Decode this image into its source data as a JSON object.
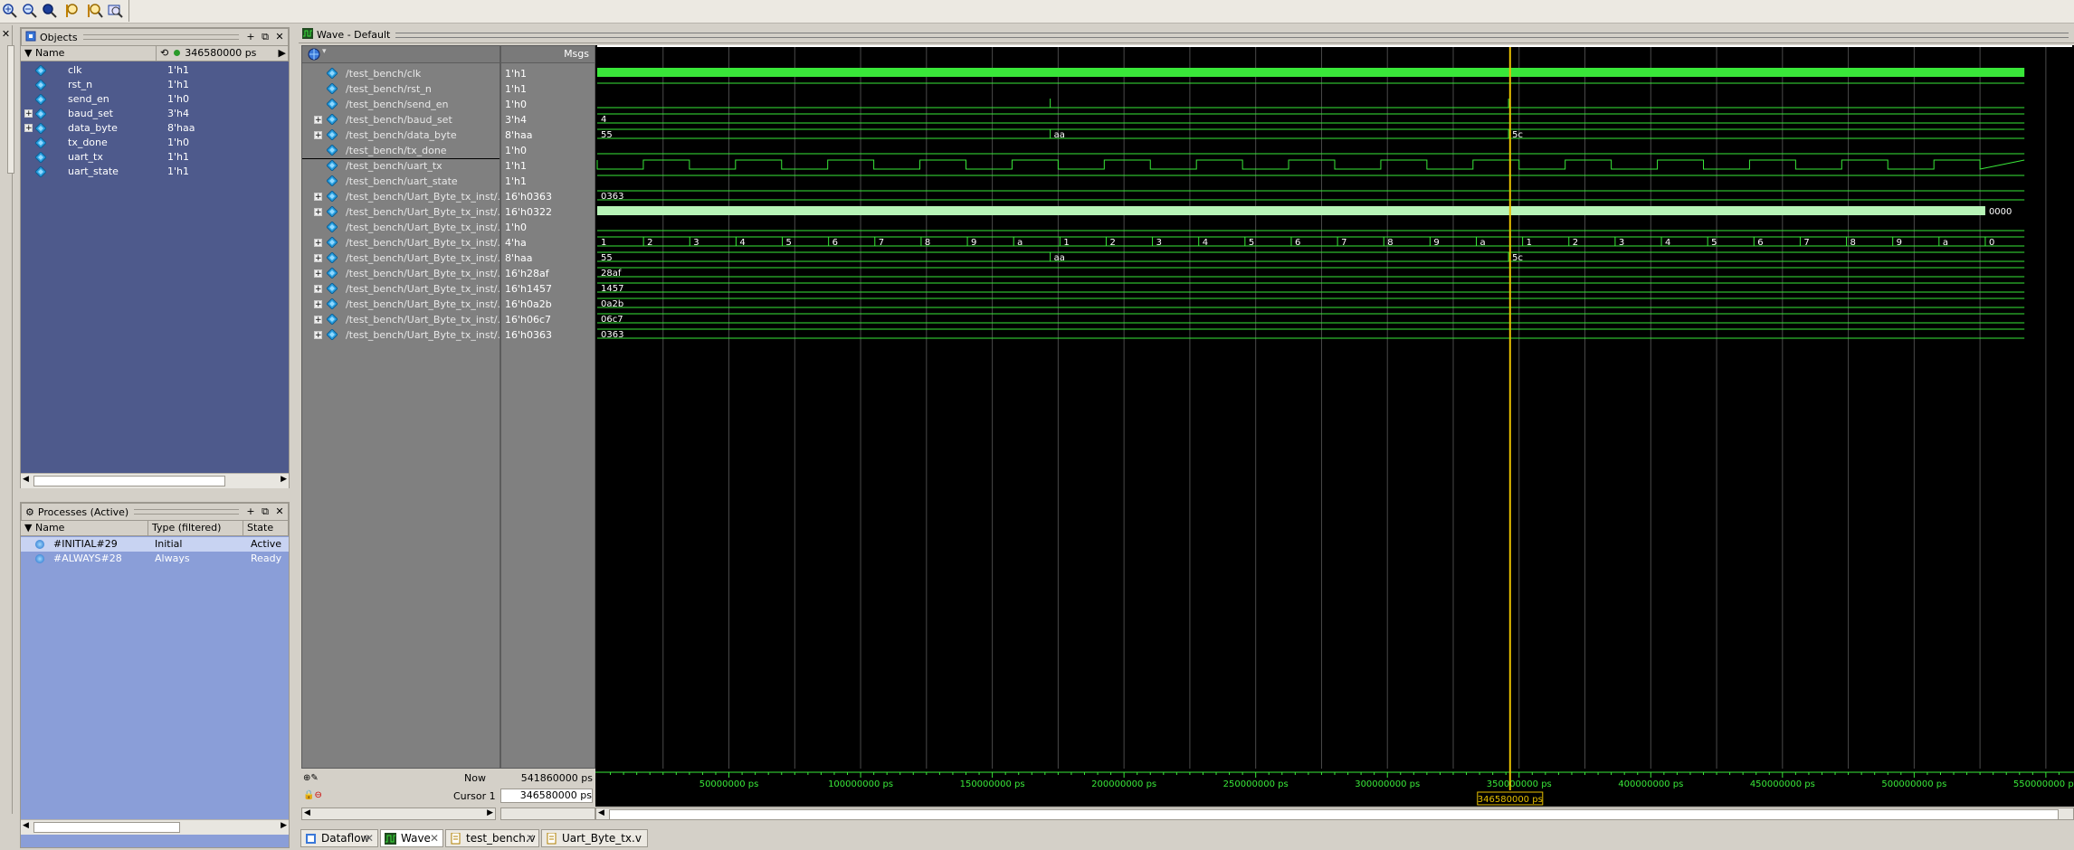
{
  "toolbar": {
    "icons": [
      "zoom-in-icon",
      "zoom-out-icon",
      "zoom-full-icon",
      "zoom-cursor-icon",
      "zoom-last-icon",
      "zoom-range-icon"
    ]
  },
  "left_strip": {
    "close": "✕"
  },
  "objects": {
    "title": "Objects",
    "col_name": "Name",
    "time": "346580000 ps",
    "signals": [
      {
        "name": "clk",
        "value": "1'h1",
        "expand": false
      },
      {
        "name": "rst_n",
        "value": "1'h1",
        "expand": false
      },
      {
        "name": "send_en",
        "value": "1'h0",
        "expand": false
      },
      {
        "name": "baud_set",
        "value": "3'h4",
        "expand": true
      },
      {
        "name": "data_byte",
        "value": "8'haa",
        "expand": true
      },
      {
        "name": "tx_done",
        "value": "1'h0",
        "expand": false
      },
      {
        "name": "uart_tx",
        "value": "1'h1",
        "expand": false
      },
      {
        "name": "uart_state",
        "value": "1'h1",
        "expand": false
      }
    ]
  },
  "processes": {
    "title": "Processes (Active)",
    "col_name": "Name",
    "col_type": "Type (filtered)",
    "col_state": "State",
    "rows": [
      {
        "name": "#INITIAL#29",
        "type": "Initial",
        "state": "Active"
      },
      {
        "name": "#ALWAYS#28",
        "type": "Always",
        "state": "Ready"
      }
    ]
  },
  "wave": {
    "title": "Wave - Default",
    "msgs_label": "Msgs",
    "signals": [
      {
        "name": "/test_bench/clk",
        "value": "1'h1",
        "expand": false
      },
      {
        "name": "/test_bench/rst_n",
        "value": "1'h1",
        "expand": false
      },
      {
        "name": "/test_bench/send_en",
        "value": "1'h0",
        "expand": false
      },
      {
        "name": "/test_bench/baud_set",
        "value": "3'h4",
        "expand": true
      },
      {
        "name": "/test_bench/data_byte",
        "value": "8'haa",
        "expand": true
      },
      {
        "name": "/test_bench/tx_done",
        "value": "1'h0",
        "expand": false
      },
      {
        "name": "/test_bench/uart_tx",
        "value": "1'h1",
        "expand": false
      },
      {
        "name": "/test_bench/uart_state",
        "value": "1'h1",
        "expand": false
      },
      {
        "name": "/test_bench/Uart_Byte_tx_inst/...",
        "value": "16'h0363",
        "expand": true
      },
      {
        "name": "/test_bench/Uart_Byte_tx_inst/...",
        "value": "16'h0322",
        "expand": true
      },
      {
        "name": "/test_bench/Uart_Byte_tx_inst/...",
        "value": "1'h0",
        "expand": false
      },
      {
        "name": "/test_bench/Uart_Byte_tx_inst/...",
        "value": "4'ha",
        "expand": true
      },
      {
        "name": "/test_bench/Uart_Byte_tx_inst/...",
        "value": "8'haa",
        "expand": true
      },
      {
        "name": "/test_bench/Uart_Byte_tx_inst/...",
        "value": "16'h28af",
        "expand": true
      },
      {
        "name": "/test_bench/Uart_Byte_tx_inst/...",
        "value": "16'h1457",
        "expand": true
      },
      {
        "name": "/test_bench/Uart_Byte_tx_inst/...",
        "value": "16'h0a2b",
        "expand": true
      },
      {
        "name": "/test_bench/Uart_Byte_tx_inst/...",
        "value": "16'h06c7",
        "expand": true
      },
      {
        "name": "/test_bench/Uart_Byte_tx_inst/...",
        "value": "16'h0363",
        "expand": true
      }
    ],
    "bus_labels": {
      "baud_set": [
        "4"
      ],
      "data_byte": [
        "55",
        "aa",
        "5c"
      ],
      "cnt0363": [
        "0363"
      ],
      "cnt0322_end": "0000",
      "bps_cnt": [
        "1",
        "2",
        "3",
        "4",
        "5",
        "6",
        "7",
        "8",
        "9",
        "a",
        "1",
        "2",
        "3",
        "4",
        "5",
        "6",
        "7",
        "8",
        "9",
        "a",
        "1",
        "2",
        "3",
        "4",
        "5",
        "6",
        "7",
        "8",
        "9",
        "a",
        "0"
      ],
      "data_reg": [
        "55",
        "aa",
        "5c"
      ],
      "c28af": [
        "28af"
      ],
      "c1457": [
        "1457"
      ],
      "c0a2b": [
        "0a2b"
      ],
      "c06c7": [
        "06c7"
      ],
      "c0363b": [
        "0363"
      ]
    },
    "now_label": "Now",
    "now_value": "541860000 ps",
    "cursor_label": "Cursor 1",
    "cursor_value": "346580000 ps",
    "cursor_flag": "346580000 ps",
    "time_ticks": [
      "50000000 ps",
      "100000000 ps",
      "150000000 ps",
      "200000000 ps",
      "250000000 ps",
      "300000000 ps",
      "350000000 ps",
      "400000000 ps",
      "450000000 ps",
      "500000000 ps",
      "550000000 ps"
    ],
    "time_tick_values": [
      50000000,
      100000000,
      150000000,
      200000000,
      250000000,
      300000000,
      350000000,
      400000000,
      450000000,
      500000000,
      550000000
    ],
    "cursor_time": 346580000,
    "colors": {
      "wave": "#39e739",
      "cursor": "#e8c000",
      "grid": "#4a4a4a"
    }
  },
  "tabs": [
    {
      "label": "Dataflow"
    },
    {
      "label": "Wave"
    },
    {
      "label": "test_bench.v"
    },
    {
      "label": "Uart_Byte_tx.v"
    }
  ]
}
